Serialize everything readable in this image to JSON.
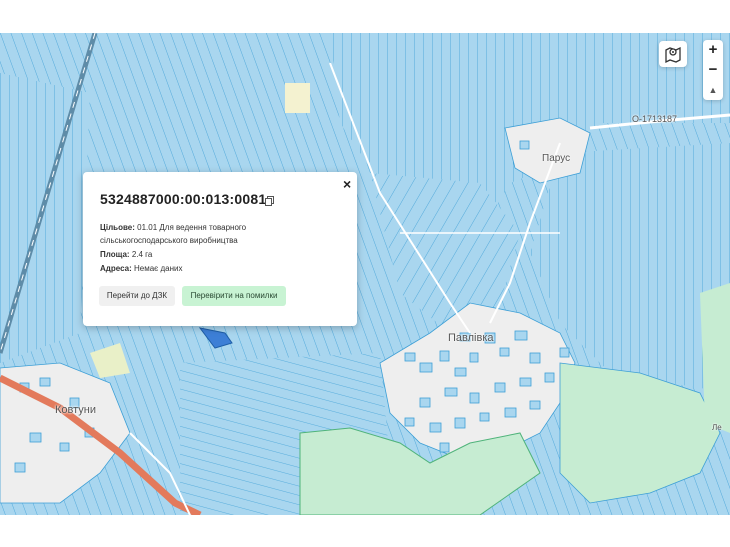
{
  "popup": {
    "title": "5324887000:00:013:0081",
    "purpose_label": "Цільове:",
    "purpose_value": "01.01 Для ведення товарного сільськогосподарського виробництва",
    "area_label": "Площа:",
    "area_value": "2.4 га",
    "address_label": "Адреса:",
    "address_value": "Немає даних",
    "btn_dzk": "Перейти до ДЗК",
    "btn_check": "Перевірити на помилки",
    "close_symbol": "×"
  },
  "controls": {
    "zoom_in": "+",
    "zoom_out": "−",
    "compass": "▲"
  },
  "map_labels": {
    "road": "O-1713187",
    "village_1": "Парус",
    "village_2": "Павлівка",
    "village_3": "Ковтуни",
    "edge_label": "Ле"
  },
  "colors": {
    "parcel_fill": "#a9d6ef",
    "parcel_line": "#3d9fd6",
    "settlement": "#eeeeee",
    "forest": "#c6ecd2",
    "main_road": "#e37a5c",
    "button_green": "#c8f3d3"
  }
}
